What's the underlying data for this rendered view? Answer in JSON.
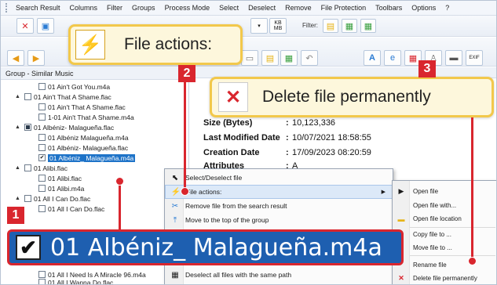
{
  "menubar": {
    "items": [
      "Search Result",
      "Columns",
      "Filter",
      "Groups",
      "Process Mode",
      "Select",
      "Deselect",
      "Remove",
      "File Protection",
      "Toolbars",
      "Options",
      "?"
    ]
  },
  "toolbar": {
    "filter_label": "Filter:",
    "kb_label": "KB\nMB"
  },
  "left_panel": {
    "title": "Group - Similar Music",
    "rows": [
      {
        "label": "01 Ain't Got You.m4a",
        "indent": 2,
        "check": "none",
        "expand": ""
      },
      {
        "label": "01 Ain't That A Shame.flac",
        "indent": 1,
        "check": "none",
        "expand": "▲"
      },
      {
        "label": "01 Ain't That A Shame.flac",
        "indent": 2,
        "check": "none",
        "expand": ""
      },
      {
        "label": "1-01 Ain't That A Shame.m4a",
        "indent": 2,
        "check": "none",
        "expand": ""
      },
      {
        "label": "01 Albéniz- Malagueña.flac",
        "indent": 1,
        "check": "partial",
        "expand": "▲"
      },
      {
        "label": "01 Albéniz  Malagueña.m4a",
        "indent": 2,
        "check": "none",
        "expand": ""
      },
      {
        "label": "01 Albéniz- Malagueña.flac",
        "indent": 2,
        "check": "none",
        "expand": ""
      },
      {
        "label": "01 Albéniz_ Malagueña.m4a",
        "indent": 2,
        "check": "checked",
        "expand": "",
        "selected": true
      },
      {
        "label": "01 Alibi.flac",
        "indent": 1,
        "check": "none",
        "expand": "▲"
      },
      {
        "label": "01 Alibi.flac",
        "indent": 2,
        "check": "none",
        "expand": ""
      },
      {
        "label": "01 Alibi.m4a",
        "indent": 2,
        "check": "none",
        "expand": ""
      },
      {
        "label": "01 All I Can Do.flac",
        "indent": 1,
        "check": "none",
        "expand": "▲"
      },
      {
        "label": "01 All I Can Do.flac",
        "indent": 2,
        "check": "none",
        "expand": ""
      }
    ],
    "bottom_rows": [
      "01 All I Need Is A Miracle  96.m4a",
      "01 All I Wanna Do.flac"
    ]
  },
  "details": {
    "fields": [
      {
        "label": "Size (Bytes)",
        "value": "10,123,336"
      },
      {
        "label": "Last Modified Date",
        "value": "10/07/2021 18:58:55"
      },
      {
        "label": "Creation Date",
        "value": "17/09/2023 08:20:59"
      },
      {
        "label": "Attributes",
        "value": "A"
      }
    ]
  },
  "context_menu": {
    "items": [
      {
        "label": "Select/Deselect file",
        "icon": "cursor-icon"
      },
      {
        "label": "File actions:",
        "icon": "lightning-icon",
        "submenu": true,
        "highlighted": true
      },
      {
        "label": "Remove file from the search result",
        "icon": "scissors-icon"
      },
      {
        "label": "Move to the top of the group",
        "icon": "move-top-icon"
      },
      {
        "label": "Deselect all files with the same path",
        "icon": "deselect-icon"
      }
    ]
  },
  "submenu": {
    "items": [
      {
        "label": "Open file",
        "icon": "play-icon"
      },
      {
        "label": "Open file with...",
        "icon": ""
      },
      {
        "label": "Open file location",
        "icon": "folder-icon"
      },
      {
        "label": "Copy file to ...",
        "icon": ""
      },
      {
        "label": "Move file to ...",
        "icon": ""
      },
      {
        "label": "Rename file",
        "icon": ""
      },
      {
        "label": "Delete file permanently",
        "icon": "delete-x-icon"
      }
    ]
  },
  "callouts": {
    "one": {
      "badge": "1",
      "text": "01 Albéniz_ Malagueña.m4a"
    },
    "two": {
      "badge": "2",
      "text": "File actions:"
    },
    "three": {
      "badge": "3",
      "text": "Delete file permanently"
    }
  },
  "colors": {
    "accent": "#d9262e",
    "callout_bg": "#fdf7dc",
    "callout_border": "#f2c84b",
    "selection": "#1e5fb0"
  }
}
